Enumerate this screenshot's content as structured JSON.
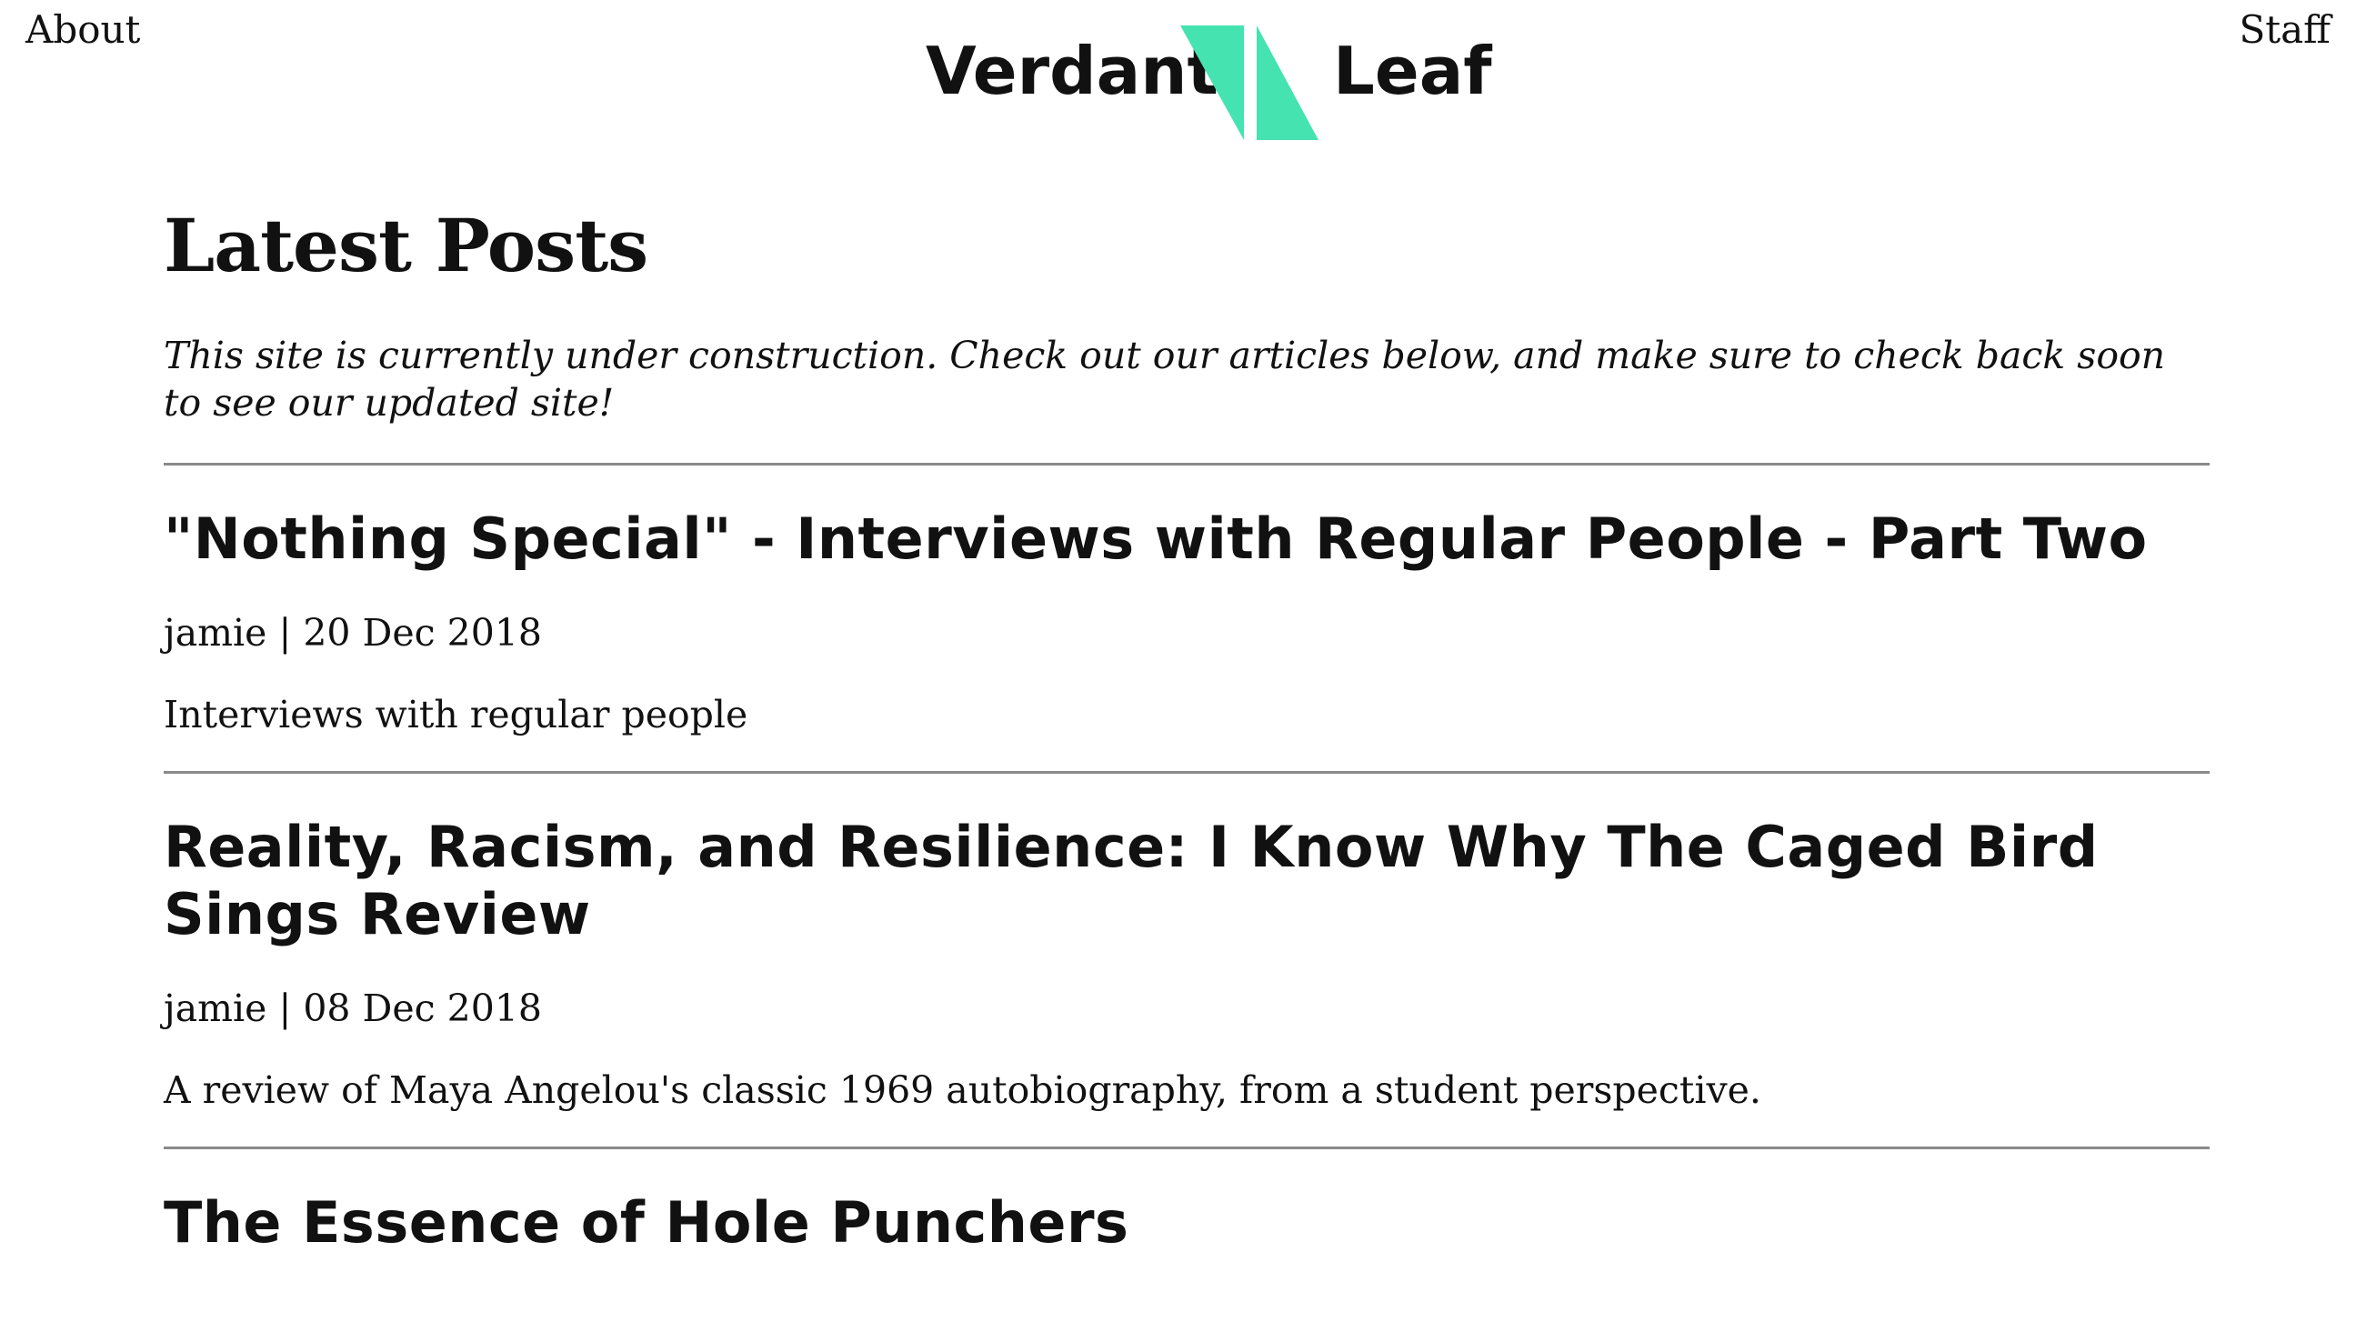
{
  "nav": {
    "about_label": "About",
    "staff_label": "Staff"
  },
  "brand": {
    "name_left": "Verdant",
    "name_right": "Leaf",
    "logo_icon": "green-slanted-leaf-shapes",
    "accent_color": "#45e3b0"
  },
  "main": {
    "title": "Latest Posts",
    "notice": "This site is currently under construction. Check out our articles below, and make sure to check back soon to see our updated site!",
    "posts": [
      {
        "title": "\"Nothing Special\" - Interviews with Regular People - Part Two",
        "author": "jamie",
        "date": "20 Dec 2018",
        "description": "Interviews with regular people"
      },
      {
        "title": "Reality, Racism, and Resilience: I Know Why The Caged Bird Sings Review",
        "author": "jamie",
        "date": "08 Dec 2018",
        "description": "A review of Maya Angelou's classic 1969 autobiography, from a student perspective."
      },
      {
        "title": "The Essence of Hole Punchers"
      }
    ]
  }
}
